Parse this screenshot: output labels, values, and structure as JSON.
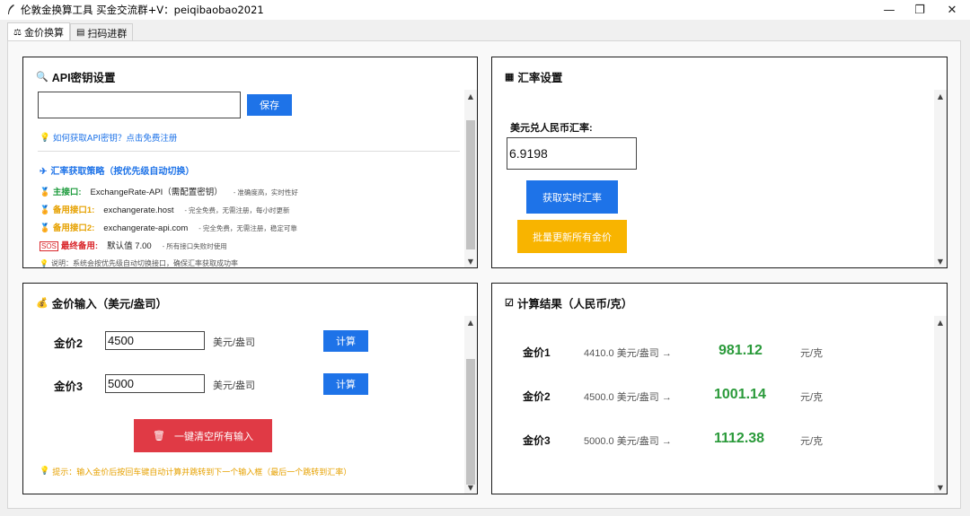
{
  "window": {
    "title": "伦敦金换算工具 买金交流群+V：peiqibaobao2021",
    "minimize": "—",
    "restore": "❐",
    "close": "✕"
  },
  "tabs": [
    {
      "label": "金价换算",
      "icon": "scale-icon"
    },
    {
      "label": "扫码进群",
      "icon": "page-icon"
    }
  ],
  "api_panel": {
    "title": "API密钥设置",
    "key_value": "",
    "save_label": "保存",
    "help_link": "如何获取API密钥？点击免费注册",
    "strategy_title": "汇率获取策略（按优先级自动切换）",
    "sources": [
      {
        "label": "主接口:",
        "value": "ExchangeRate-API（需配置密钥）",
        "desc": "- 准确度高，实时性好",
        "color": "green",
        "icon": "medal-icon"
      },
      {
        "label": "备用接口1:",
        "value": "exchangerate.host",
        "desc": "- 完全免费，无需注册，每小时更新",
        "color": "orange",
        "icon": "medal-icon"
      },
      {
        "label": "备用接口2:",
        "value": "exchangerate-api.com",
        "desc": "- 完全免费，无需注册，稳定可靠",
        "color": "orange",
        "icon": "medal-icon"
      },
      {
        "label": "最终备用:",
        "value": "默认值 7.00",
        "desc": "- 所有接口失败时使用",
        "color": "red",
        "icon": "sos-icon"
      }
    ],
    "note": "说明：系统会按优先级自动切换接口，确保汇率获取成功率"
  },
  "rate_panel": {
    "title": "汇率设置",
    "rate_label": "美元兑人民币汇率:",
    "rate_value": "6.9198",
    "fetch_label": "获取实时汇率",
    "batch_label": "批量更新所有金价"
  },
  "input_panel": {
    "title": "金价输入（美元/盎司）",
    "rows": [
      {
        "label": "金价2",
        "value": "4500",
        "unit": "美元/盎司",
        "button": "计算"
      },
      {
        "label": "金价3",
        "value": "5000",
        "unit": "美元/盎司",
        "button": "计算"
      }
    ],
    "clear_label": "一键清空所有输入",
    "tip": "提示：输入金价后按回车键自动计算并跳转到下一个输入框（最后一个跳转到汇率）"
  },
  "result_panel": {
    "title": "计算结果（人民币/克）",
    "rows": [
      {
        "label": "金价1",
        "input": "4410.0 美元/盎司 →",
        "value": "981.12",
        "unit": "元/克"
      },
      {
        "label": "金价2",
        "input": "4500.0 美元/盎司 →",
        "value": "1001.14",
        "unit": "元/克"
      },
      {
        "label": "金价3",
        "input": "5000.0 美元/盎司 →",
        "value": "1112.38",
        "unit": "元/克"
      }
    ]
  },
  "colors": {
    "accent_blue": "#1e73e8",
    "batch_yellow": "#f8b400",
    "clear_red": "#e03a45",
    "result_green": "#2a9a3a"
  }
}
